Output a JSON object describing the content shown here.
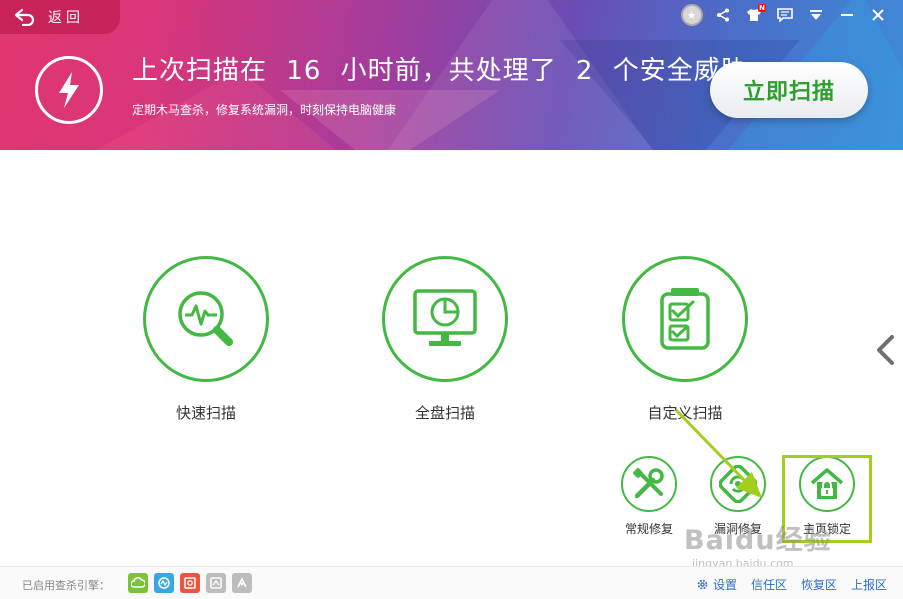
{
  "header": {
    "back_label": "返回",
    "headline_prefix": "上次扫描在",
    "headline_hours": "16",
    "headline_mid": "小时前，共处理了",
    "headline_count": "2",
    "headline_suffix": "个安全威胁",
    "subline": "定期木马查杀，修复系统漏洞，时刻保持电脑健康",
    "scan_button": "立即扫描",
    "notification_badge": "N",
    "topbar_icons": [
      "medal-icon",
      "share-icon",
      "shirt-icon",
      "message-icon",
      "dropdown-icon",
      "minimize-icon",
      "close-icon"
    ]
  },
  "scan_options": [
    {
      "label": "快速扫描",
      "icon": "quick-scan-icon"
    },
    {
      "label": "全盘扫描",
      "icon": "full-scan-icon"
    },
    {
      "label": "自定义扫描",
      "icon": "custom-scan-icon"
    }
  ],
  "tools": [
    {
      "label": "常规修复",
      "icon": "wrench-icon"
    },
    {
      "label": "漏洞修复",
      "icon": "vuln-repair-icon"
    },
    {
      "label": "主页锁定",
      "icon": "lock-home-icon"
    }
  ],
  "footer": {
    "engine_label": "已启用查杀引擎：",
    "engines": [
      {
        "name": "cloud-engine-icon",
        "color": "#7bc43a"
      },
      {
        "name": "qvm-engine-icon",
        "color": "#3aa7e0"
      },
      {
        "name": "avira-engine-icon",
        "color": "#e9573f"
      },
      {
        "name": "system-repair-engine-icon",
        "color": "#bdbdbd"
      },
      {
        "name": "bitdefender-engine-icon",
        "color": "#bdbdbd"
      }
    ],
    "links": [
      "设置",
      "信任区",
      "恢复区",
      "上报区"
    ]
  },
  "watermark": {
    "brand": "Baidu经验",
    "url": "jingyan.baidu.com"
  },
  "colors": {
    "accent_green": "#43b943",
    "link_blue": "#2f6fc2",
    "annotation": "#a2cf1b"
  }
}
